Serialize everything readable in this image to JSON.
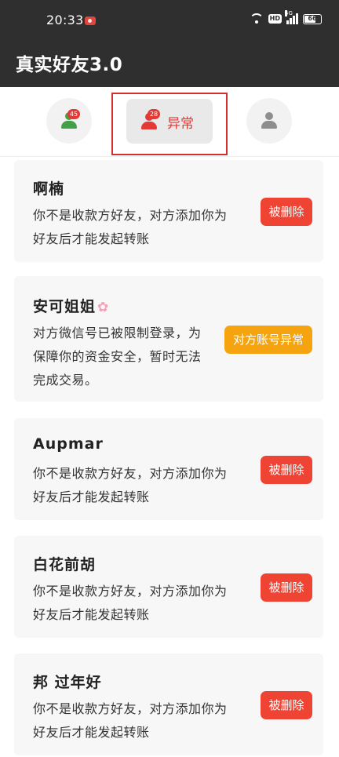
{
  "status_bar": {
    "time": "20:33",
    "hd": "HD",
    "signal_tag": "5G",
    "battery": "66"
  },
  "app": {
    "title": "真实好友3.0"
  },
  "tabs": {
    "friends_badge": "45",
    "abnormal_badge": "28",
    "abnormal_label": "异常"
  },
  "colors": {
    "danger": "#ef4434",
    "warning": "#f5a40f",
    "topbar": "#2f2f2f",
    "success": "#43a047"
  },
  "list": [
    {
      "name": "啊楠",
      "line1": "你不是收款方好友，对方添加你为",
      "line2": "好友后才能发起转账",
      "status": "被删除"
    },
    {
      "name": "安可姐姐",
      "line1": "对方微信号已被限制登录，为",
      "line2": "保障你的资金安全，暂时无法",
      "line3": "完成交易。",
      "status": "对方账号异常"
    },
    {
      "name": "Aupmar",
      "line1": "你不是收款方好友，对方添加你为",
      "line2": "好友后才能发起转账",
      "status": "被删除"
    },
    {
      "name": "白花前胡",
      "line1": "你不是收款方好友，对方添加你为",
      "line2": "好友后才能发起转账",
      "status": "被删除"
    },
    {
      "name": "邦 过年好",
      "line1": "你不是收款方好友，对方添加你为",
      "line2": "好友后才能发起转账",
      "status": "被删除"
    }
  ]
}
